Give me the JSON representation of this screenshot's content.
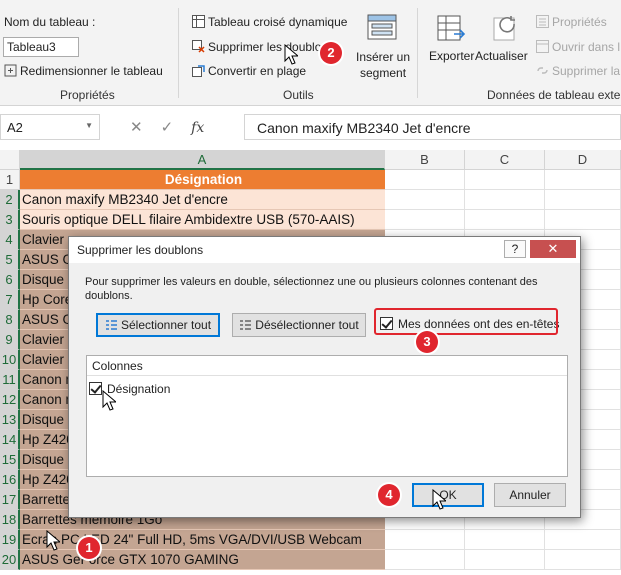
{
  "ribbon": {
    "table_name_label": "Nom du tableau :",
    "table_name_value": "Tableau3",
    "resize_label": "Redimensionner le tableau",
    "group_properties": "Propriétés",
    "pivot_label": "Tableau croisé dynamique",
    "remove_duplicates_label": "Supprimer les doublons",
    "convert_label": "Convertir en plage",
    "insert_slicer_label_1": "Insérer un",
    "insert_slicer_label_2": "segment",
    "group_tools": "Outils",
    "export_label": "Exporter",
    "refresh_label": "Actualiser",
    "properties_label": "Propriétés",
    "open_browser_label": "Ouvrir dans l",
    "unlink_label": "Supprimer la",
    "group_external": "Données de tableau extern"
  },
  "formula_bar": {
    "name_box": "A2",
    "fx": "fx",
    "content": "Canon maxify MB2340 Jet d'encre"
  },
  "grid": {
    "columns": [
      "A",
      "B",
      "C",
      "D"
    ],
    "rows": [
      {
        "num": "1",
        "text": "Désignation"
      },
      {
        "num": "2",
        "text": "Canon maxify MB2340 Jet d'encre"
      },
      {
        "num": "3",
        "text": "Souris optique DELL filaire Ambidextre USB (570-AAIS)"
      },
      {
        "num": "4",
        "text": "Clavier"
      },
      {
        "num": "5",
        "text": "ASUS G"
      },
      {
        "num": "6",
        "text": "Disque"
      },
      {
        "num": "7",
        "text": "Hp Core"
      },
      {
        "num": "8",
        "text": "ASUS G"
      },
      {
        "num": "9",
        "text": "Clavier"
      },
      {
        "num": "10",
        "text": "Clavier"
      },
      {
        "num": "11",
        "text": "Canon m"
      },
      {
        "num": "12",
        "text": "Canon m"
      },
      {
        "num": "13",
        "text": "Disque"
      },
      {
        "num": "14",
        "text": "Hp Z420"
      },
      {
        "num": "15",
        "text": "Disque"
      },
      {
        "num": "16",
        "text": "Hp Z420"
      },
      {
        "num": "17",
        "text": "Barrette"
      },
      {
        "num": "18",
        "text": "Barrettes mémoire 1Go"
      },
      {
        "num": "19",
        "text": "Ecran PC LED 24\" Full HD, 5ms VGA/DVI/USB Webcam"
      },
      {
        "num": "20",
        "text": "ASUS GeForce GTX 1070 GAMING"
      }
    ]
  },
  "dialog": {
    "title": "Supprimer les doublons",
    "help": "?",
    "close": "✕",
    "message": "Pour supprimer les valeurs en double, sélectionnez une ou plusieurs colonnes contenant des doublons.",
    "select_all": "Sélectionner tout",
    "unselect_all": "Désélectionner tout",
    "headers_checkbox": "Mes données ont des en-têtes",
    "columns_header": "Colonnes",
    "column_item": "Désignation",
    "ok": "OK",
    "cancel": "Annuler"
  },
  "markers": [
    "1",
    "2",
    "3",
    "4"
  ],
  "colors": {
    "accent": "#ed7d31",
    "light_row": "#fce4d6",
    "highlight": "#e0262e",
    "excel_green": "#217346"
  }
}
